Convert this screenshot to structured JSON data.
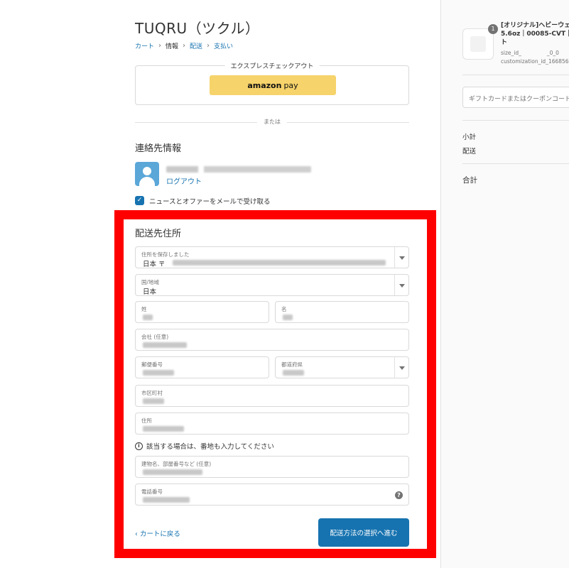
{
  "shop": {
    "title": "TUQRU（ツクル）"
  },
  "breadcrumb": {
    "cart": "カート",
    "info": "情報",
    "shipping": "配送",
    "payment": "支払い"
  },
  "express": {
    "label": "エクスプレスチェックアウト",
    "amazon": "amazon",
    "pay": "pay"
  },
  "divider_text": "または",
  "contact": {
    "title": "連絡先情報",
    "logout": "ログアウト",
    "newsletter_label": "ニュースとオファーをメールで受け取る"
  },
  "shipping": {
    "title": "配送先住所",
    "saved_address_label": "住所を保存しました",
    "saved_address_value": "日本 〒",
    "country_label": "国/地域",
    "country_value": "日本",
    "last_name_label": "姓",
    "first_name_label": "名",
    "company_label": "会社 (任意)",
    "postal_label": "郵便番号",
    "prefecture_label": "都道府県",
    "city_label": "市区町村",
    "address_label": "住所",
    "address_hint": "該当する場合は、番地も入力してください",
    "building_label": "建物名、部屋番号など (任意)",
    "phone_label": "電話番号"
  },
  "actions": {
    "back": "‹ カートに戻る",
    "continue": "配送方法の選択へ進む"
  },
  "sidebar": {
    "qty": "1",
    "product_line1": "[オリジナル]ヘビーウェ",
    "product_line2": "5.6oz｜00085-CVT｜",
    "product_line3": "ト",
    "meta1": "size_id_",
    "meta1b": "_0_0",
    "meta2": "customization_id_166856",
    "coupon_placeholder": "ギフトカードまたはクーポンコード",
    "subtotal": "小計",
    "shipping": "配送",
    "total": "合計"
  },
  "colors": {
    "accent": "#1773b0",
    "highlight": "#ff0000",
    "amazon": "#f6d36b"
  }
}
